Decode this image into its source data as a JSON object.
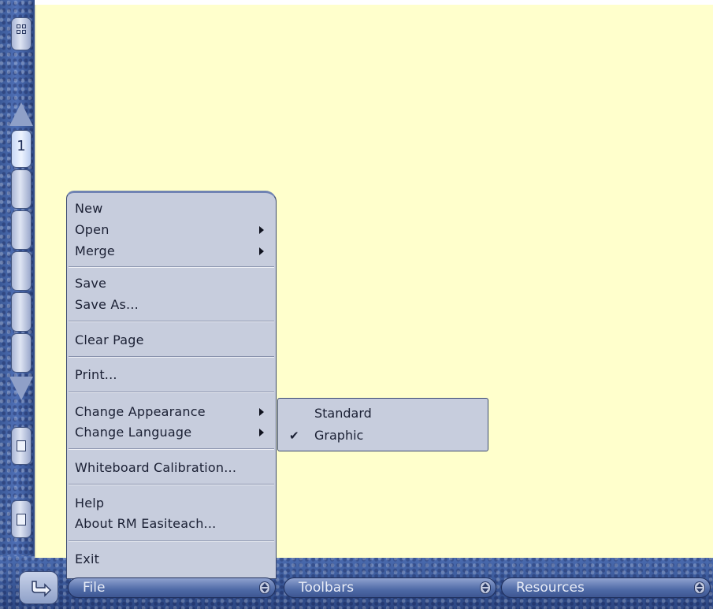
{
  "side_panel": {
    "page_number": "1"
  },
  "file_menu": {
    "items": {
      "new": "New",
      "open": "Open",
      "merge": "Merge",
      "save": "Save",
      "save_as": "Save As...",
      "clear_page": "Clear Page",
      "print": "Print...",
      "change_appearance": "Change Appearance",
      "change_language": "Change Language",
      "whiteboard_calibration": "Whiteboard Calibration...",
      "help": "Help",
      "about": "About RM Easiteach...",
      "exit": "Exit"
    }
  },
  "appearance_submenu": {
    "items": [
      "Standard",
      "Graphic"
    ],
    "checked": "Graphic",
    "check_glyph": "✔"
  },
  "bottom_bar": {
    "file": "File",
    "toolbars": "Toolbars",
    "resources": "Resources"
  },
  "colors": {
    "canvas": "#ffffcc",
    "frame": "#3c5a98",
    "menu": "#c7cddd"
  }
}
